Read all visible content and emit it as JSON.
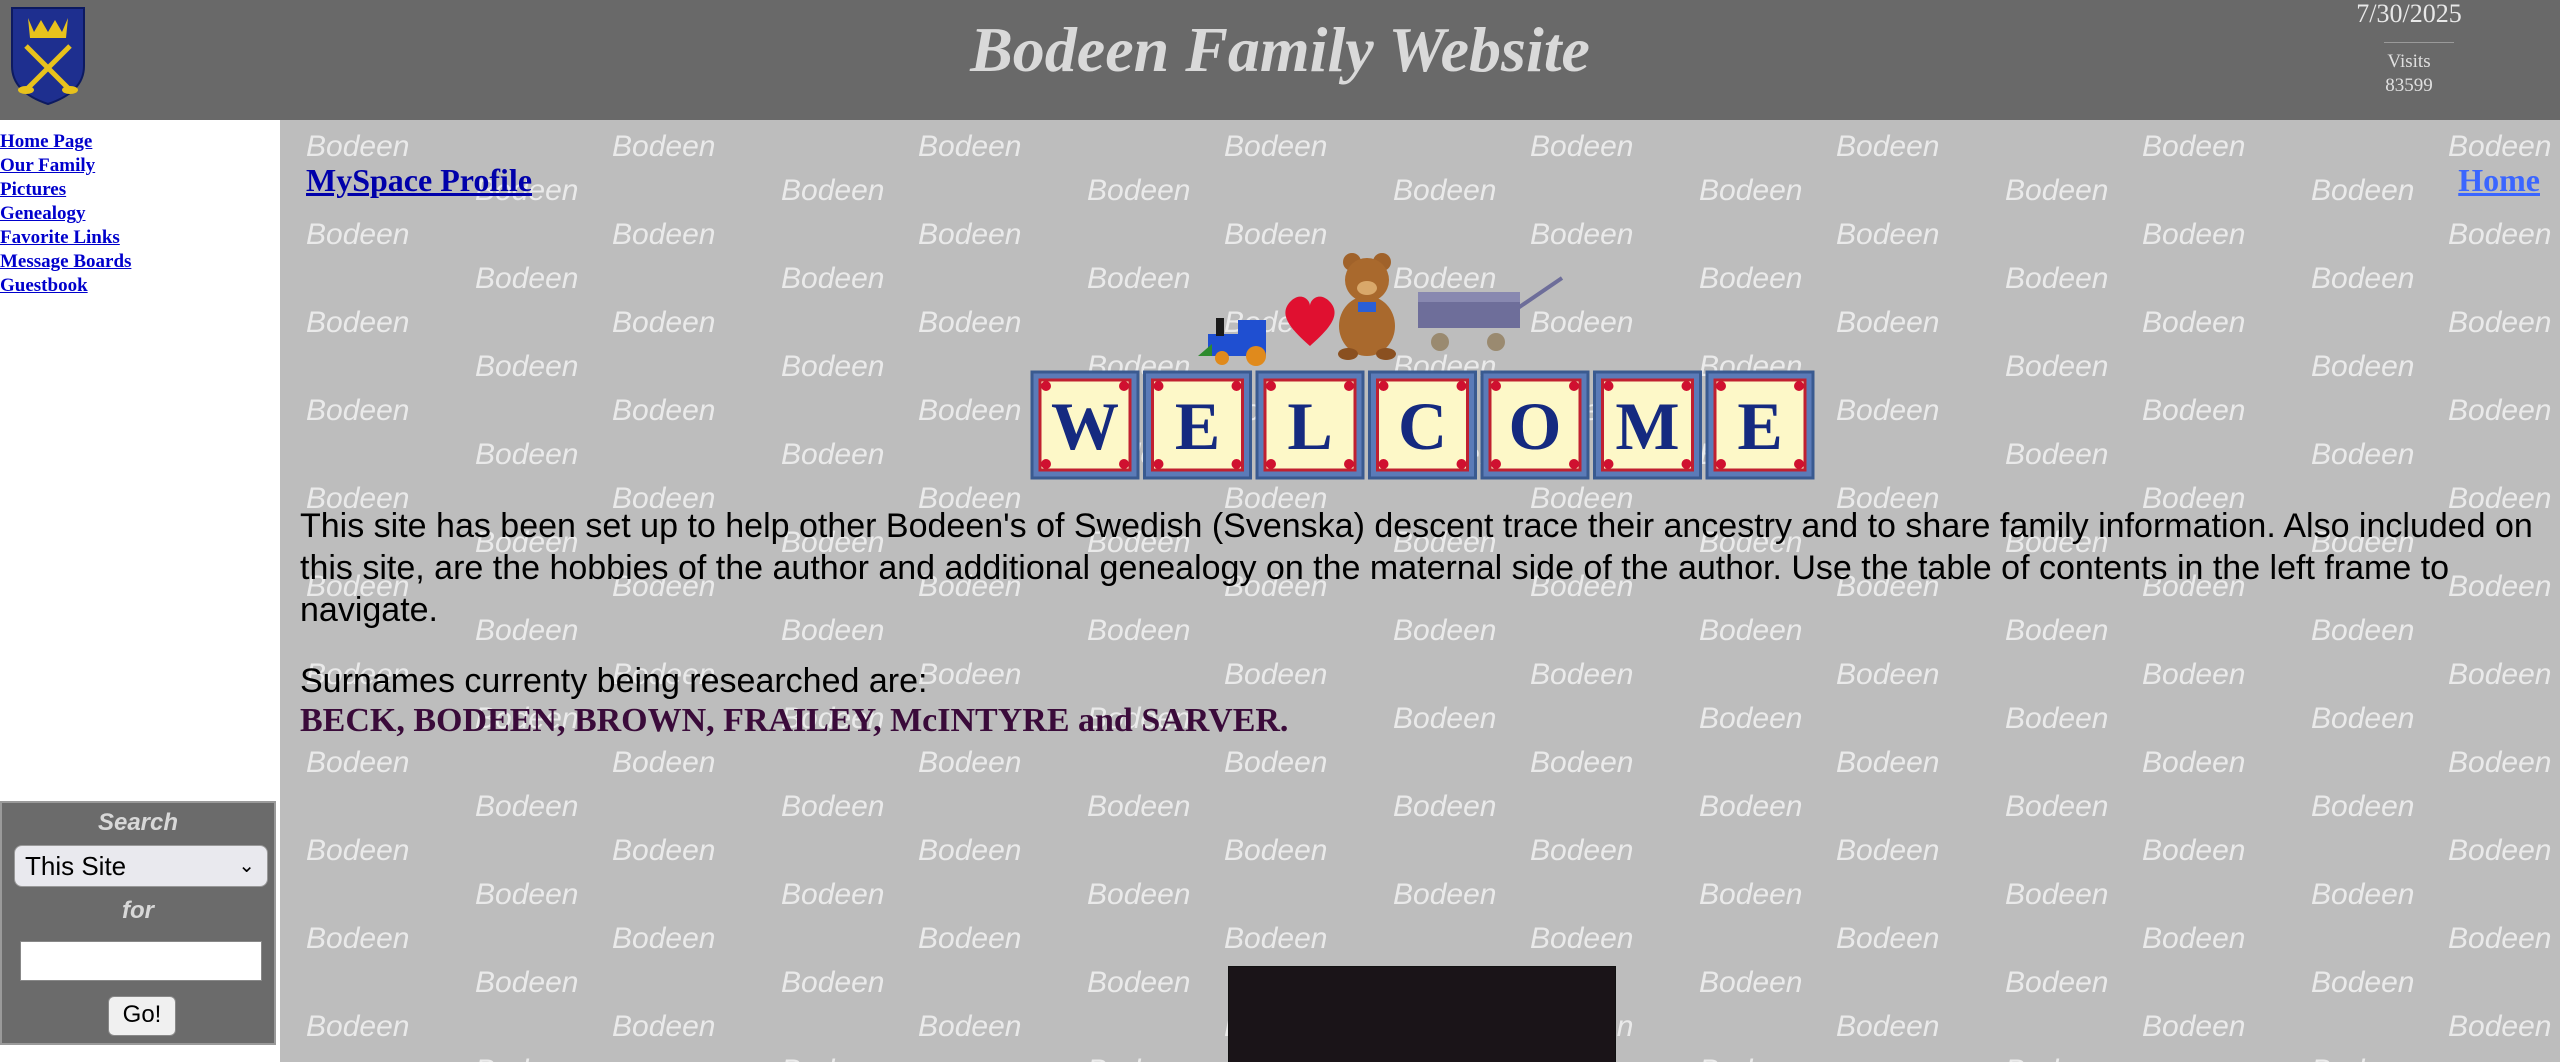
{
  "header": {
    "title": "Bodeen Family Website",
    "date": "7/30/2025",
    "visits_label": "Visits",
    "visits_count": "83599"
  },
  "nav": {
    "items": [
      {
        "label": "Home Page"
      },
      {
        "label": "Our Family"
      },
      {
        "label": "Pictures"
      },
      {
        "label": "Genealogy"
      },
      {
        "label": "Favorite Links"
      },
      {
        "label": "Message Boards"
      },
      {
        "label": "Guestbook"
      }
    ]
  },
  "search": {
    "label": "Search",
    "scope_selected": "This Site",
    "for_label": "for",
    "go_label": "Go!"
  },
  "main": {
    "watermark_text": "Bodeen",
    "myspace_link": "MySpace Profile",
    "home_link": "Home",
    "welcome_letters": [
      "W",
      "E",
      "L",
      "C",
      "O",
      "M",
      "E"
    ],
    "intro": "This site has been set up to help other Bodeen's of Swedish (Svenska) descent trace their ancestry and to share family information. Also included on this site, are the hobbies of the author and additional genealogy on the maternal side of the author.  Use the table of contents in the left frame to navigate.",
    "surnames_label": "Surnames currenty being researched are:",
    "surnames": "BECK, BODEEN, BROWN, FRAILEY, McINTYRE and SARVER."
  },
  "colors": {
    "header_bg": "#696969",
    "main_bg": "#bdbdbd",
    "link": "#0000cc",
    "surnames": "#3a0b3a",
    "crest_blue": "#1e2f8f",
    "crest_gold": "#e8c21c"
  }
}
